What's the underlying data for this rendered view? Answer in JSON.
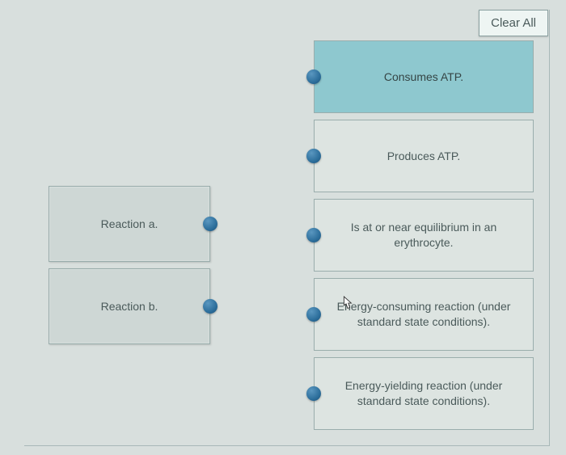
{
  "buttons": {
    "clear_all": "Clear All"
  },
  "left": {
    "items": [
      {
        "label": "Reaction a."
      },
      {
        "label": "Reaction b."
      }
    ]
  },
  "right": {
    "items": [
      {
        "label": "Consumes ATP.",
        "highlight": true
      },
      {
        "label": "Produces ATP."
      },
      {
        "label": "Is at or near equilibrium in an erythrocyte."
      },
      {
        "label": "Energy-consuming reaction (under standard state conditions)."
      },
      {
        "label": "Energy-yielding reaction (under standard state conditions)."
      }
    ]
  }
}
